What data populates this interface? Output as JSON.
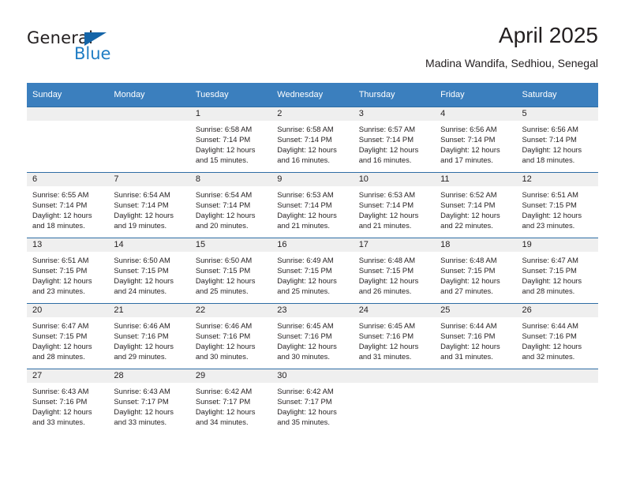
{
  "brand": {
    "name_top": "General",
    "name_bottom": "Blue",
    "triangle_color": "#1565a8",
    "blue_color": "#1f7dc4"
  },
  "header": {
    "title": "April 2025",
    "subtitle": "Madina Wandifa, Sedhiou, Senegal"
  },
  "theme": {
    "header_bg": "#3b7fbe",
    "row_rule": "#2e6da4",
    "daynum_band": "#efefef"
  },
  "weekday_headers": [
    "Sunday",
    "Monday",
    "Tuesday",
    "Wednesday",
    "Thursday",
    "Friday",
    "Saturday"
  ],
  "weeks": [
    [
      {
        "day": "",
        "empty": true,
        "sunrise": "",
        "sunset": "",
        "daylight_1": "",
        "daylight_2": ""
      },
      {
        "day": "",
        "empty": true,
        "sunrise": "",
        "sunset": "",
        "daylight_1": "",
        "daylight_2": ""
      },
      {
        "day": "1",
        "sunrise": "Sunrise: 6:58 AM",
        "sunset": "Sunset: 7:14 PM",
        "daylight_1": "Daylight: 12 hours",
        "daylight_2": "and 15 minutes."
      },
      {
        "day": "2",
        "sunrise": "Sunrise: 6:58 AM",
        "sunset": "Sunset: 7:14 PM",
        "daylight_1": "Daylight: 12 hours",
        "daylight_2": "and 16 minutes."
      },
      {
        "day": "3",
        "sunrise": "Sunrise: 6:57 AM",
        "sunset": "Sunset: 7:14 PM",
        "daylight_1": "Daylight: 12 hours",
        "daylight_2": "and 16 minutes."
      },
      {
        "day": "4",
        "sunrise": "Sunrise: 6:56 AM",
        "sunset": "Sunset: 7:14 PM",
        "daylight_1": "Daylight: 12 hours",
        "daylight_2": "and 17 minutes."
      },
      {
        "day": "5",
        "sunrise": "Sunrise: 6:56 AM",
        "sunset": "Sunset: 7:14 PM",
        "daylight_1": "Daylight: 12 hours",
        "daylight_2": "and 18 minutes."
      }
    ],
    [
      {
        "day": "6",
        "sunrise": "Sunrise: 6:55 AM",
        "sunset": "Sunset: 7:14 PM",
        "daylight_1": "Daylight: 12 hours",
        "daylight_2": "and 18 minutes."
      },
      {
        "day": "7",
        "sunrise": "Sunrise: 6:54 AM",
        "sunset": "Sunset: 7:14 PM",
        "daylight_1": "Daylight: 12 hours",
        "daylight_2": "and 19 minutes."
      },
      {
        "day": "8",
        "sunrise": "Sunrise: 6:54 AM",
        "sunset": "Sunset: 7:14 PM",
        "daylight_1": "Daylight: 12 hours",
        "daylight_2": "and 20 minutes."
      },
      {
        "day": "9",
        "sunrise": "Sunrise: 6:53 AM",
        "sunset": "Sunset: 7:14 PM",
        "daylight_1": "Daylight: 12 hours",
        "daylight_2": "and 21 minutes."
      },
      {
        "day": "10",
        "sunrise": "Sunrise: 6:53 AM",
        "sunset": "Sunset: 7:14 PM",
        "daylight_1": "Daylight: 12 hours",
        "daylight_2": "and 21 minutes."
      },
      {
        "day": "11",
        "sunrise": "Sunrise: 6:52 AM",
        "sunset": "Sunset: 7:14 PM",
        "daylight_1": "Daylight: 12 hours",
        "daylight_2": "and 22 minutes."
      },
      {
        "day": "12",
        "sunrise": "Sunrise: 6:51 AM",
        "sunset": "Sunset: 7:15 PM",
        "daylight_1": "Daylight: 12 hours",
        "daylight_2": "and 23 minutes."
      }
    ],
    [
      {
        "day": "13",
        "sunrise": "Sunrise: 6:51 AM",
        "sunset": "Sunset: 7:15 PM",
        "daylight_1": "Daylight: 12 hours",
        "daylight_2": "and 23 minutes."
      },
      {
        "day": "14",
        "sunrise": "Sunrise: 6:50 AM",
        "sunset": "Sunset: 7:15 PM",
        "daylight_1": "Daylight: 12 hours",
        "daylight_2": "and 24 minutes."
      },
      {
        "day": "15",
        "sunrise": "Sunrise: 6:50 AM",
        "sunset": "Sunset: 7:15 PM",
        "daylight_1": "Daylight: 12 hours",
        "daylight_2": "and 25 minutes."
      },
      {
        "day": "16",
        "sunrise": "Sunrise: 6:49 AM",
        "sunset": "Sunset: 7:15 PM",
        "daylight_1": "Daylight: 12 hours",
        "daylight_2": "and 25 minutes."
      },
      {
        "day": "17",
        "sunrise": "Sunrise: 6:48 AM",
        "sunset": "Sunset: 7:15 PM",
        "daylight_1": "Daylight: 12 hours",
        "daylight_2": "and 26 minutes."
      },
      {
        "day": "18",
        "sunrise": "Sunrise: 6:48 AM",
        "sunset": "Sunset: 7:15 PM",
        "daylight_1": "Daylight: 12 hours",
        "daylight_2": "and 27 minutes."
      },
      {
        "day": "19",
        "sunrise": "Sunrise: 6:47 AM",
        "sunset": "Sunset: 7:15 PM",
        "daylight_1": "Daylight: 12 hours",
        "daylight_2": "and 28 minutes."
      }
    ],
    [
      {
        "day": "20",
        "sunrise": "Sunrise: 6:47 AM",
        "sunset": "Sunset: 7:15 PM",
        "daylight_1": "Daylight: 12 hours",
        "daylight_2": "and 28 minutes."
      },
      {
        "day": "21",
        "sunrise": "Sunrise: 6:46 AM",
        "sunset": "Sunset: 7:16 PM",
        "daylight_1": "Daylight: 12 hours",
        "daylight_2": "and 29 minutes."
      },
      {
        "day": "22",
        "sunrise": "Sunrise: 6:46 AM",
        "sunset": "Sunset: 7:16 PM",
        "daylight_1": "Daylight: 12 hours",
        "daylight_2": "and 30 minutes."
      },
      {
        "day": "23",
        "sunrise": "Sunrise: 6:45 AM",
        "sunset": "Sunset: 7:16 PM",
        "daylight_1": "Daylight: 12 hours",
        "daylight_2": "and 30 minutes."
      },
      {
        "day": "24",
        "sunrise": "Sunrise: 6:45 AM",
        "sunset": "Sunset: 7:16 PM",
        "daylight_1": "Daylight: 12 hours",
        "daylight_2": "and 31 minutes."
      },
      {
        "day": "25",
        "sunrise": "Sunrise: 6:44 AM",
        "sunset": "Sunset: 7:16 PM",
        "daylight_1": "Daylight: 12 hours",
        "daylight_2": "and 31 minutes."
      },
      {
        "day": "26",
        "sunrise": "Sunrise: 6:44 AM",
        "sunset": "Sunset: 7:16 PM",
        "daylight_1": "Daylight: 12 hours",
        "daylight_2": "and 32 minutes."
      }
    ],
    [
      {
        "day": "27",
        "sunrise": "Sunrise: 6:43 AM",
        "sunset": "Sunset: 7:16 PM",
        "daylight_1": "Daylight: 12 hours",
        "daylight_2": "and 33 minutes."
      },
      {
        "day": "28",
        "sunrise": "Sunrise: 6:43 AM",
        "sunset": "Sunset: 7:17 PM",
        "daylight_1": "Daylight: 12 hours",
        "daylight_2": "and 33 minutes."
      },
      {
        "day": "29",
        "sunrise": "Sunrise: 6:42 AM",
        "sunset": "Sunset: 7:17 PM",
        "daylight_1": "Daylight: 12 hours",
        "daylight_2": "and 34 minutes."
      },
      {
        "day": "30",
        "sunrise": "Sunrise: 6:42 AM",
        "sunset": "Sunset: 7:17 PM",
        "daylight_1": "Daylight: 12 hours",
        "daylight_2": "and 35 minutes."
      },
      {
        "day": "",
        "empty": true,
        "sunrise": "",
        "sunset": "",
        "daylight_1": "",
        "daylight_2": ""
      },
      {
        "day": "",
        "empty": true,
        "sunrise": "",
        "sunset": "",
        "daylight_1": "",
        "daylight_2": ""
      },
      {
        "day": "",
        "empty": true,
        "sunrise": "",
        "sunset": "",
        "daylight_1": "",
        "daylight_2": ""
      }
    ]
  ]
}
